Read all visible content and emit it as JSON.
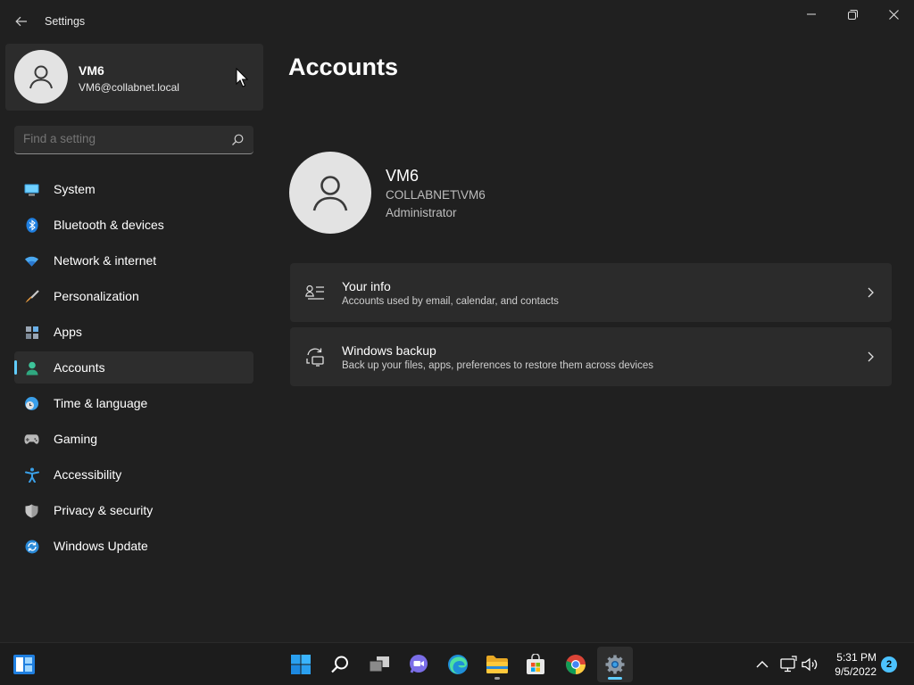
{
  "window": {
    "title": "Settings"
  },
  "profile": {
    "name": "VM6",
    "email": "VM6@collabnet.local"
  },
  "search": {
    "placeholder": "Find a setting"
  },
  "nav": {
    "items": [
      {
        "label": "System",
        "icon": "system-icon"
      },
      {
        "label": "Bluetooth & devices",
        "icon": "bluetooth-icon"
      },
      {
        "label": "Network & internet",
        "icon": "wifi-icon"
      },
      {
        "label": "Personalization",
        "icon": "brush-icon"
      },
      {
        "label": "Apps",
        "icon": "apps-icon"
      },
      {
        "label": "Accounts",
        "icon": "accounts-icon",
        "selected": true
      },
      {
        "label": "Time & language",
        "icon": "clock-globe-icon"
      },
      {
        "label": "Gaming",
        "icon": "gamepad-icon"
      },
      {
        "label": "Accessibility",
        "icon": "accessibility-icon"
      },
      {
        "label": "Privacy & security",
        "icon": "shield-icon"
      },
      {
        "label": "Windows Update",
        "icon": "update-icon"
      }
    ]
  },
  "main": {
    "title": "Accounts",
    "account": {
      "name": "VM6",
      "domain": "COLLABNET\\VM6",
      "role": "Administrator"
    },
    "cards": [
      {
        "title": "Your info",
        "subtitle": "Accounts used by email, calendar, and contacts",
        "icon": "contact-info-icon"
      },
      {
        "title": "Windows backup",
        "subtitle": "Back up your files, apps, preferences to restore them across devices",
        "icon": "sync-backup-icon"
      }
    ]
  },
  "taskbar": {
    "time": "5:31 PM",
    "date": "9/5/2022",
    "notification_count": "2"
  },
  "colors": {
    "accent": "#60cdff",
    "background": "#202020",
    "card": "#2b2b2b"
  }
}
